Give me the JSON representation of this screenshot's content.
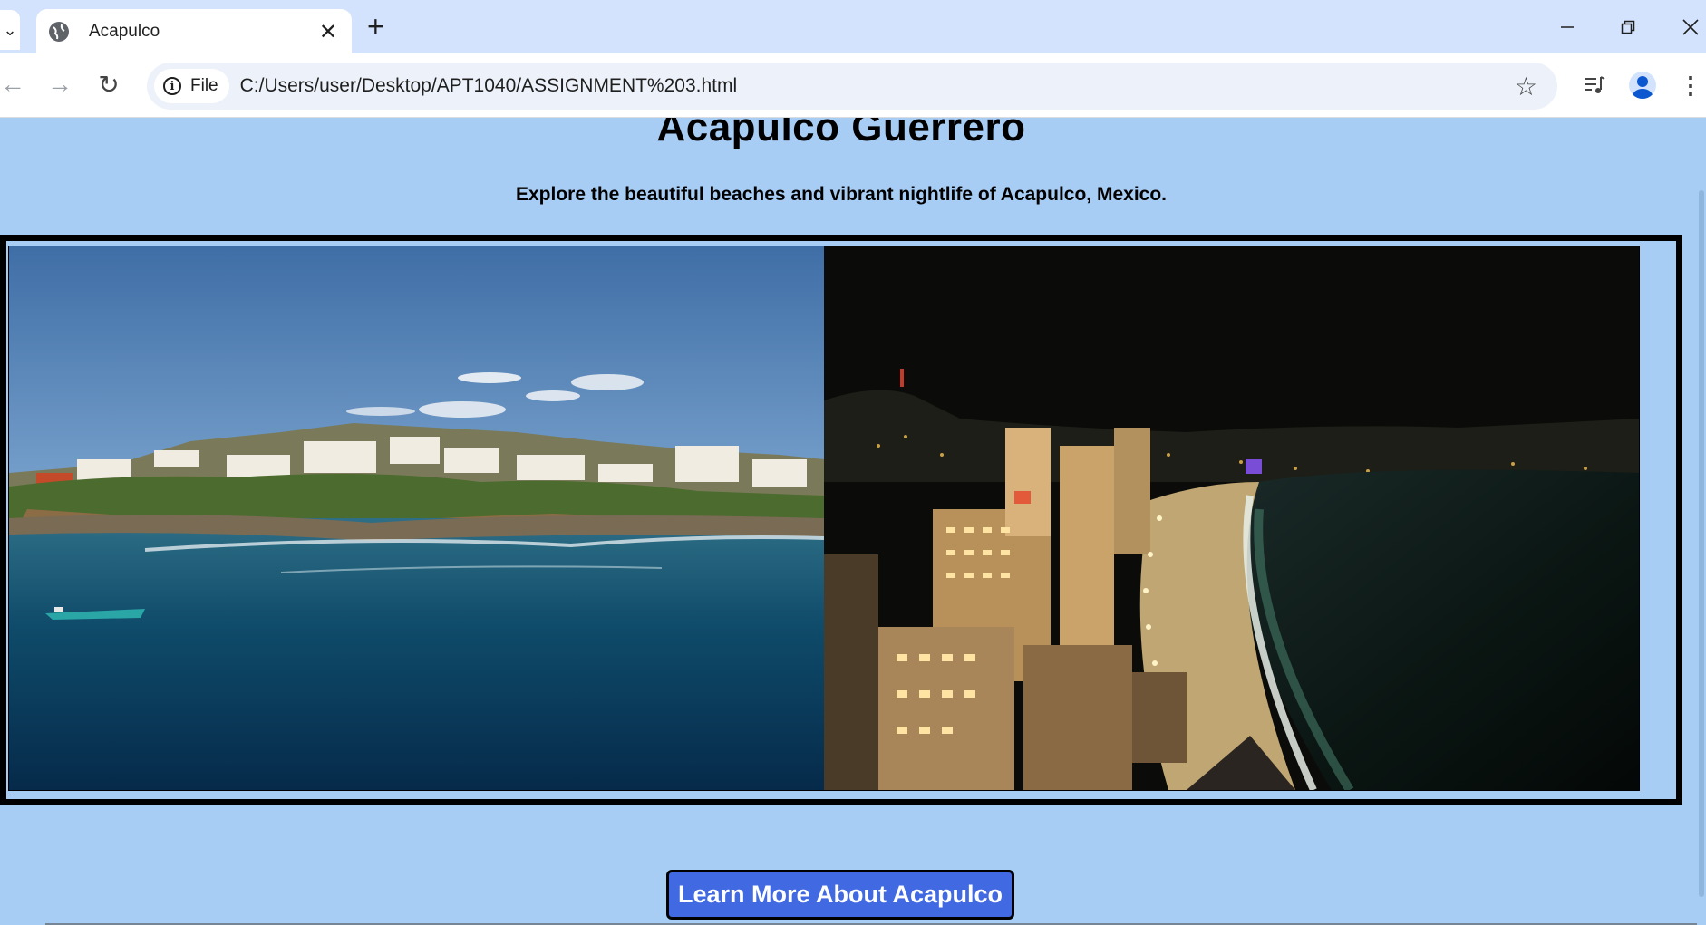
{
  "browser": {
    "tab_title": "Acapulco",
    "address_chip": "File",
    "url": "C:/Users/user/Desktop/APT1040/ASSIGNMENT%203.html",
    "icons": [
      "tab-dropdown-icon",
      "globe-icon",
      "close-icon",
      "plus-icon",
      "minimize-icon",
      "restore-icon",
      "window-close-icon",
      "back-icon",
      "forward-icon",
      "reload-icon",
      "info-icon",
      "star-icon",
      "media-icon",
      "profile-icon",
      "menu-icon"
    ]
  },
  "page": {
    "title": "Acapulco Guerrero",
    "subtitle": "Explore the beautiful beaches and vibrant nightlife of Acapulco, Mexico.",
    "cta_label": "Learn More About Acapulco",
    "background_color": "#a8cdf5",
    "button_color": "#4169e1"
  },
  "gallery": {
    "images": [
      "day-coast-photo",
      "night-beach-photo"
    ]
  }
}
